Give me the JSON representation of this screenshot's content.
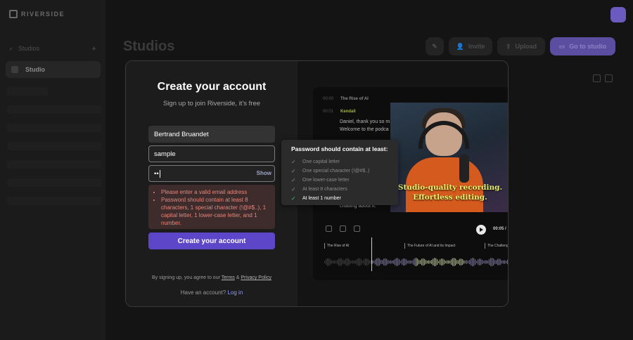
{
  "app": {
    "logo_text": "RIVERSIDE",
    "sidebar": {
      "search_label": "Studios",
      "studio_item": "Studio"
    },
    "page_title": "Studios",
    "toolbar": {
      "invite": "Invite",
      "upload": "Upload",
      "go_to_studio": "Go to studio"
    }
  },
  "signup": {
    "title": "Create your account",
    "subtitle": "Sign up to join Riverside, it's free",
    "name_value": "Bertrand Bruandet",
    "email_value": "sample",
    "password_value": "••",
    "show_label": "Show",
    "errors": [
      "Please enter a valid email address",
      "Password should contain at least 8 characters, 1 special character (!@#$..), 1 capital letter, 1 lower-case letter, and 1 number."
    ],
    "submit_label": "Create your account",
    "terms_prefix": "By signing up, you agree to our",
    "terms_link": "Terms",
    "terms_amp": "&",
    "privacy_link": "Privacy Policy",
    "login_prefix": "Have an account?",
    "login_link": "Log in"
  },
  "password_tooltip": {
    "title": "Password should contain at least:",
    "rules": [
      {
        "label": "One capital letter",
        "met": false
      },
      {
        "label": "One special character (!@#$..)",
        "met": false
      },
      {
        "label": "One lower-case letter",
        "met": false
      },
      {
        "label": "At least 8 characters",
        "met": false
      },
      {
        "label": "At least 1 number",
        "met": true
      }
    ]
  },
  "preview": {
    "transcript_title": "The Rise of AI",
    "speaker": "Kendall",
    "line1": "Daniel, thank you so m",
    "line2": "Welcome to the podca",
    "line3": "chatting about it.",
    "caption_line1": "Studio-quality recording.",
    "caption_line2": "Effortless editing.",
    "timecode": "00:05 /",
    "segments": [
      "The Rise of AI",
      "The Future of AI and its Impact",
      "The Challeng"
    ]
  },
  "colors": {
    "accent": "#5d47c8",
    "error_bg": "#3d2c2b",
    "error_text": "#e8867b",
    "check_met": "#3ecf6a"
  }
}
